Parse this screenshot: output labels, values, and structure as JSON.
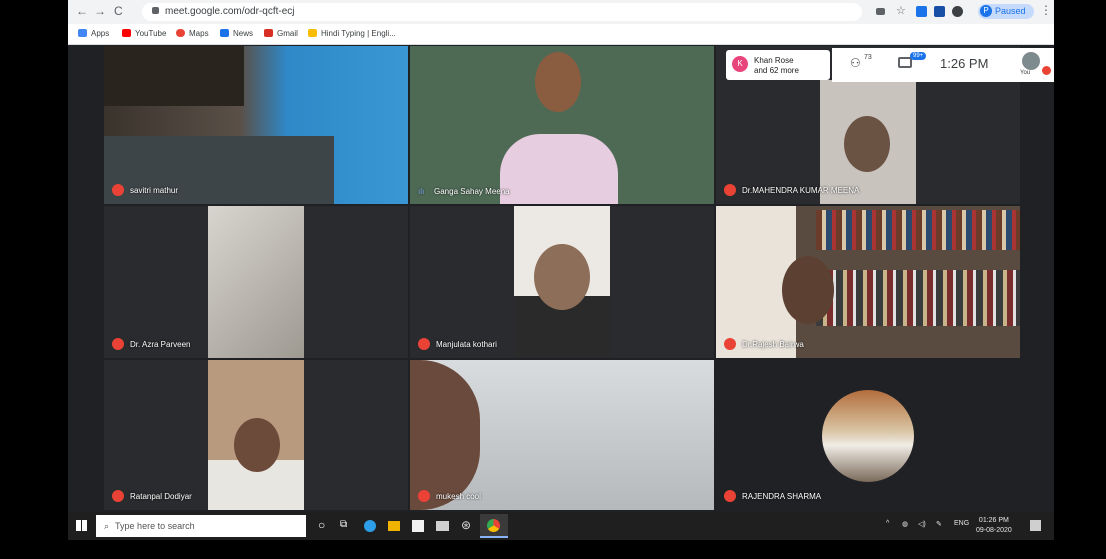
{
  "browser": {
    "url": "meet.google.com/odr-qcft-ecj",
    "profile_label": "Paused",
    "profile_initial": "P",
    "bookmarks": [
      "Apps",
      "YouTube",
      "Maps",
      "News",
      "Gmail",
      "Hindi Typing | Engli..."
    ]
  },
  "meet": {
    "participants": [
      {
        "name": "savitri mathur",
        "muted": true
      },
      {
        "name": "Ganga Sahay Meena",
        "muted": false,
        "speaking": true
      },
      {
        "name": "Dr.MAHENDRA KUMAR MEENA",
        "muted": true
      },
      {
        "name": "Dr. Azra Parveen",
        "muted": true
      },
      {
        "name": "Manjulata kothari",
        "muted": true
      },
      {
        "name": "Dr.Rajesh Bairwa",
        "muted": true
      },
      {
        "name": "Ratanpal Dodiyar",
        "muted": true
      },
      {
        "name": "mukesh cool",
        "muted": true
      },
      {
        "name": "RAJENDRA SHARMA",
        "muted": true
      }
    ],
    "presenter_card": {
      "initial": "K",
      "line1": "Khan Rose",
      "line2": "and 62 more"
    },
    "people_count": "73",
    "chat_badge": "99+",
    "time": "1:26 PM",
    "you_label": "You"
  },
  "taskbar": {
    "search_placeholder": "Type here to search",
    "language": "ENG",
    "clock_time": "01:26 PM",
    "clock_date": "09-08-2020"
  },
  "colors": {
    "mic_off": "#ea4335",
    "meet_bg": "#202124",
    "accent": "#1a73e8"
  }
}
